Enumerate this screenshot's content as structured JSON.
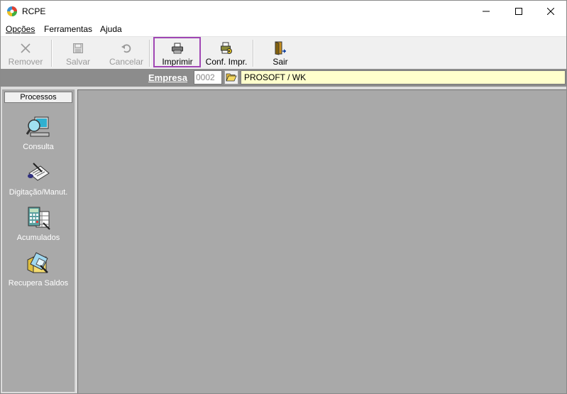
{
  "window": {
    "title": "RCPE"
  },
  "menu": {
    "items": [
      {
        "label": "Opções"
      },
      {
        "label": "Ferramentas"
      },
      {
        "label": "Ajuda"
      }
    ]
  },
  "toolbar": {
    "remover": "Remover",
    "salvar": "Salvar",
    "cancelar": "Cancelar",
    "imprimir": "Imprimir",
    "conf_impr": "Conf. Impr.",
    "sair": "Sair",
    "highlight_color": "#a046b4"
  },
  "empresa": {
    "label": "Empresa",
    "code": "0002",
    "name": "PROSOFT / WK"
  },
  "sidebar": {
    "header": "Processos",
    "items": [
      {
        "label": "Consulta",
        "icon": "consulta-icon"
      },
      {
        "label": "Digitação/Manut.",
        "icon": "digitacao-icon"
      },
      {
        "label": "Acumulados",
        "icon": "acumulados-icon"
      },
      {
        "label": "Recupera Saldos",
        "icon": "recupera-saldos-icon"
      }
    ]
  }
}
